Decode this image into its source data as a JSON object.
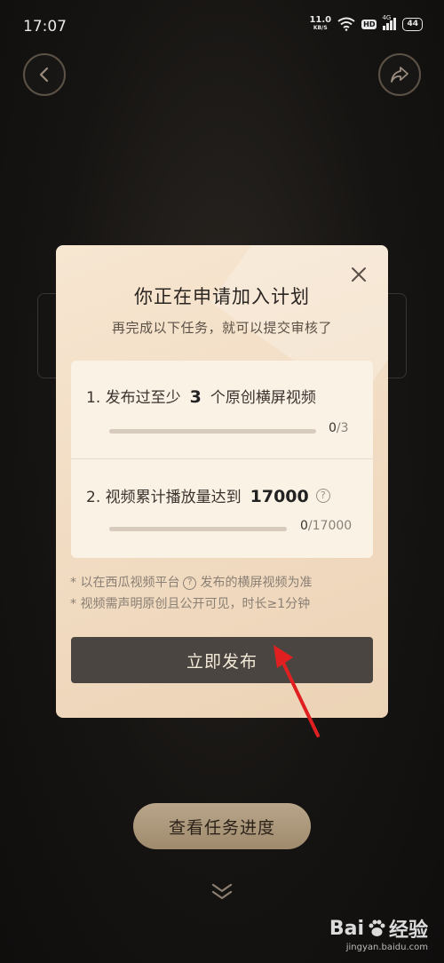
{
  "status_bar": {
    "time": "17:07",
    "speed_value": "11.0",
    "speed_unit": "KB/S",
    "hd": "HD",
    "network": "4G",
    "battery": "44"
  },
  "background": {
    "progress_button_label": "查看任务进度"
  },
  "modal": {
    "title": "你正在申请加入计划",
    "subtitle": "再完成以下任务，就可以提交审核了",
    "tasks": [
      {
        "prefix": "1. 发布过至少",
        "target": "3",
        "suffix": "个原创横屏视频",
        "current": "0",
        "total": "/3",
        "progress": 0
      },
      {
        "prefix": "2. 视频累计播放量达到",
        "target": "17000",
        "suffix": "",
        "current": "0",
        "total": "/17000",
        "progress": 0
      }
    ],
    "notes": {
      "line1_prefix": "* 以在西瓜视频平台",
      "line1_suffix": "发布的横屏视频为准",
      "line2": "* 视频需声明原创且公开可见，时长≥1分钟"
    },
    "publish_label": "立即发布"
  },
  "watermark": {
    "brand": "Bai",
    "brand_cn": "经验",
    "url": "jingyan.baidu.com"
  },
  "colors": {
    "modal_bg": "#f7e6d1",
    "publish_bg": "#4a4540",
    "arrow": "#e02020",
    "progress_button_bg": "#b9a68a"
  }
}
